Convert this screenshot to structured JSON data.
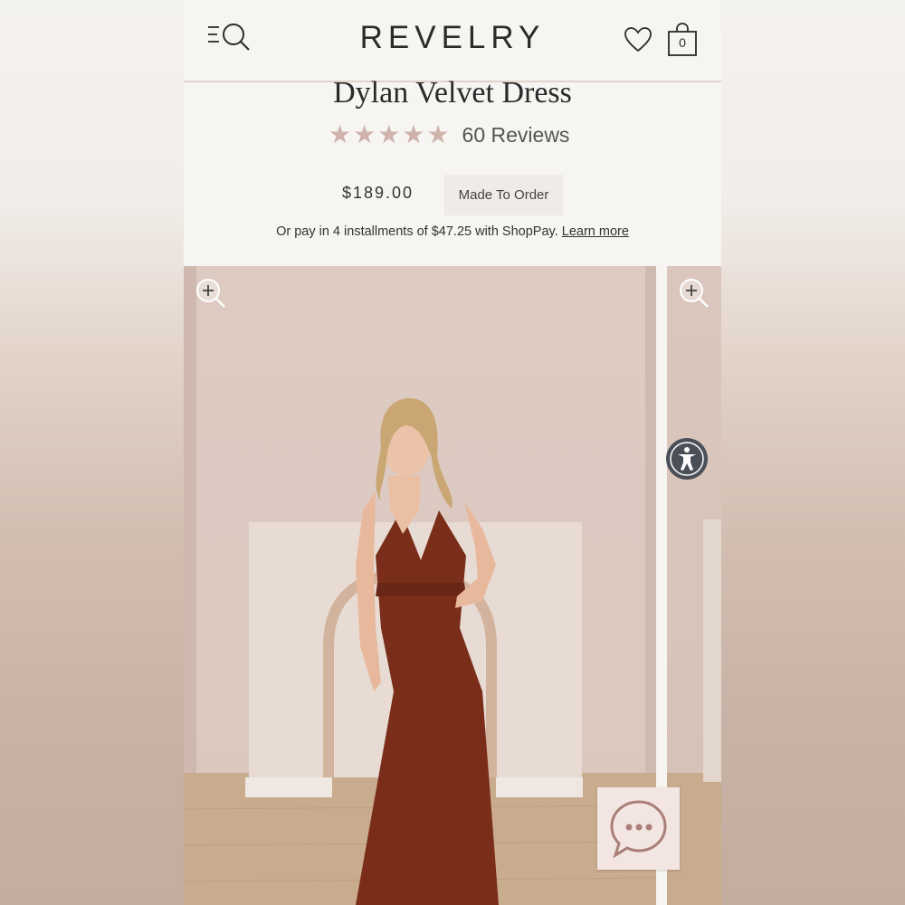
{
  "header": {
    "brand": "REVELRY",
    "bag_count": "0",
    "icons": [
      "menu-search-icon",
      "heart-icon",
      "shopping-bag-icon"
    ]
  },
  "product": {
    "title": "Dylan Velvet Dress",
    "rating_stars": 5,
    "reviews_label": "60 Reviews",
    "price": "$189.00",
    "badge": "Made To Order",
    "installment_text": "Or pay in 4 installments of $47.25 with ShopPay.",
    "learn_more": "Learn more"
  },
  "gallery": {
    "images": [
      "model-rust-velvet-gown-front",
      "model-rust-velvet-gown-next"
    ],
    "zoom_icon": "zoom-in-icon"
  },
  "widgets": {
    "accessibility_icon": "accessibility-icon",
    "chat_icon": "chat-bubble-icon"
  },
  "colors": {
    "accent_line": "#e4cfca",
    "star": "#cfb2ab",
    "dress": "#7a2e1a",
    "accessibility_bg": "#4b4f58"
  }
}
